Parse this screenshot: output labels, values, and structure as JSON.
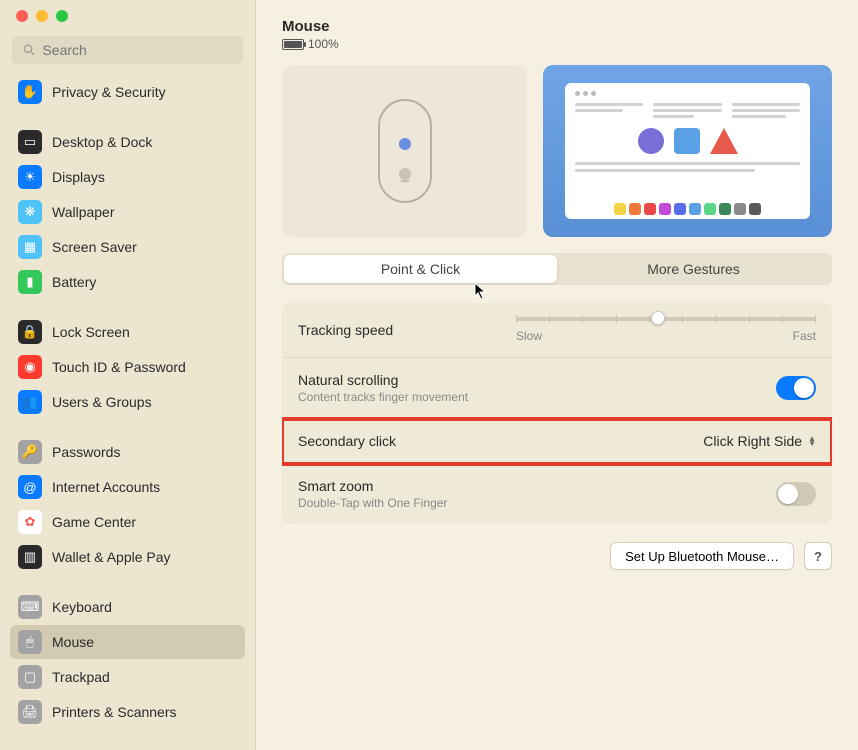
{
  "search": {
    "placeholder": "Search"
  },
  "sidebar": {
    "groups": [
      [
        {
          "label": "Privacy & Security",
          "icon": "hand-icon",
          "bg": "#0a7aff",
          "fg": "#fff"
        }
      ],
      [
        {
          "label": "Desktop & Dock",
          "icon": "dock-icon",
          "bg": "#2a2a2a",
          "fg": "#fff"
        },
        {
          "label": "Displays",
          "icon": "displays-icon",
          "bg": "#0a7aff",
          "fg": "#fff"
        },
        {
          "label": "Wallpaper",
          "icon": "wallpaper-icon",
          "bg": "#4fc3f7",
          "fg": "#fff"
        },
        {
          "label": "Screen Saver",
          "icon": "screensaver-icon",
          "bg": "#4fc3f7",
          "fg": "#fff"
        },
        {
          "label": "Battery",
          "icon": "battery-icon",
          "bg": "#34c759",
          "fg": "#fff"
        }
      ],
      [
        {
          "label": "Lock Screen",
          "icon": "lock-icon",
          "bg": "#2a2a2a",
          "fg": "#fff"
        },
        {
          "label": "Touch ID & Password",
          "icon": "touchid-icon",
          "bg": "#ff3b30",
          "fg": "#fff"
        },
        {
          "label": "Users & Groups",
          "icon": "users-icon",
          "bg": "#0a7aff",
          "fg": "#fff"
        }
      ],
      [
        {
          "label": "Passwords",
          "icon": "key-icon",
          "bg": "#a2a2a2",
          "fg": "#fff"
        },
        {
          "label": "Internet Accounts",
          "icon": "at-icon",
          "bg": "#0a7aff",
          "fg": "#fff"
        },
        {
          "label": "Game Center",
          "icon": "gamecenter-icon",
          "bg": "#ffffff",
          "fg": "#f55"
        },
        {
          "label": "Wallet & Apple Pay",
          "icon": "wallet-icon",
          "bg": "#2a2a2a",
          "fg": "#fff"
        }
      ],
      [
        {
          "label": "Keyboard",
          "icon": "keyboard-icon",
          "bg": "#a2a2a2",
          "fg": "#fff"
        },
        {
          "label": "Mouse",
          "icon": "mouse-icon",
          "bg": "#a2a2a2",
          "fg": "#fff",
          "selected": true
        },
        {
          "label": "Trackpad",
          "icon": "trackpad-icon",
          "bg": "#a2a2a2",
          "fg": "#fff"
        },
        {
          "label": "Printers & Scanners",
          "icon": "printer-icon",
          "bg": "#a2a2a2",
          "fg": "#fff"
        }
      ]
    ]
  },
  "header": {
    "title": "Mouse",
    "battery_pct": "100%"
  },
  "tabs": {
    "point_click": "Point & Click",
    "more_gestures": "More Gestures"
  },
  "settings": {
    "tracking": {
      "label": "Tracking speed",
      "slow": "Slow",
      "fast": "Fast",
      "value": 0.45
    },
    "natural": {
      "label": "Natural scrolling",
      "sub": "Content tracks finger movement",
      "on": true
    },
    "secondary": {
      "label": "Secondary click",
      "value": "Click Right Side"
    },
    "smartzoom": {
      "label": "Smart zoom",
      "sub": "Double-Tap with One Finger",
      "on": false
    }
  },
  "footer": {
    "setup": "Set Up Bluetooth Mouse…",
    "help": "?"
  },
  "dock_colors": [
    "#f5d547",
    "#f07838",
    "#e84a4a",
    "#c24ad6",
    "#5a6fe6",
    "#5aa0e6",
    "#5ad68a",
    "#3a885a",
    "#8a8a8a",
    "#5a5a5a"
  ]
}
